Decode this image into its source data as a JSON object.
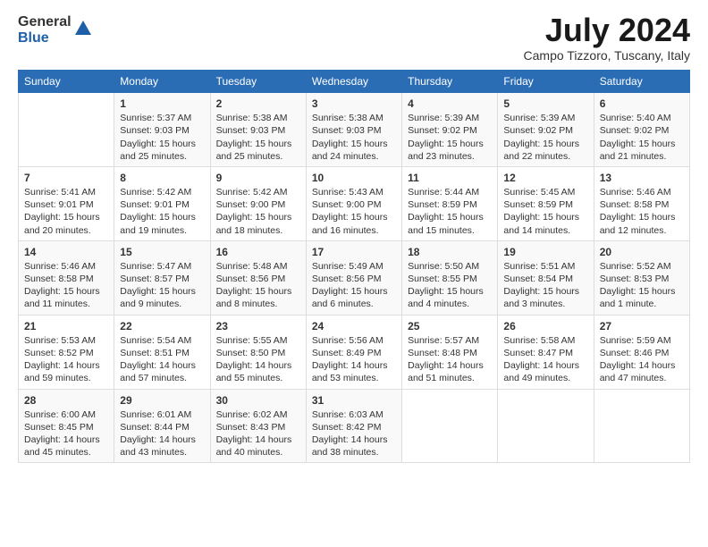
{
  "header": {
    "logo_general": "General",
    "logo_blue": "Blue",
    "month": "July 2024",
    "location": "Campo Tizzoro, Tuscany, Italy"
  },
  "weekdays": [
    "Sunday",
    "Monday",
    "Tuesday",
    "Wednesday",
    "Thursday",
    "Friday",
    "Saturday"
  ],
  "weeks": [
    [
      {
        "day": "",
        "info": ""
      },
      {
        "day": "1",
        "info": "Sunrise: 5:37 AM\nSunset: 9:03 PM\nDaylight: 15 hours\nand 25 minutes."
      },
      {
        "day": "2",
        "info": "Sunrise: 5:38 AM\nSunset: 9:03 PM\nDaylight: 15 hours\nand 25 minutes."
      },
      {
        "day": "3",
        "info": "Sunrise: 5:38 AM\nSunset: 9:03 PM\nDaylight: 15 hours\nand 24 minutes."
      },
      {
        "day": "4",
        "info": "Sunrise: 5:39 AM\nSunset: 9:02 PM\nDaylight: 15 hours\nand 23 minutes."
      },
      {
        "day": "5",
        "info": "Sunrise: 5:39 AM\nSunset: 9:02 PM\nDaylight: 15 hours\nand 22 minutes."
      },
      {
        "day": "6",
        "info": "Sunrise: 5:40 AM\nSunset: 9:02 PM\nDaylight: 15 hours\nand 21 minutes."
      }
    ],
    [
      {
        "day": "7",
        "info": "Sunrise: 5:41 AM\nSunset: 9:01 PM\nDaylight: 15 hours\nand 20 minutes."
      },
      {
        "day": "8",
        "info": "Sunrise: 5:42 AM\nSunset: 9:01 PM\nDaylight: 15 hours\nand 19 minutes."
      },
      {
        "day": "9",
        "info": "Sunrise: 5:42 AM\nSunset: 9:00 PM\nDaylight: 15 hours\nand 18 minutes."
      },
      {
        "day": "10",
        "info": "Sunrise: 5:43 AM\nSunset: 9:00 PM\nDaylight: 15 hours\nand 16 minutes."
      },
      {
        "day": "11",
        "info": "Sunrise: 5:44 AM\nSunset: 8:59 PM\nDaylight: 15 hours\nand 15 minutes."
      },
      {
        "day": "12",
        "info": "Sunrise: 5:45 AM\nSunset: 8:59 PM\nDaylight: 15 hours\nand 14 minutes."
      },
      {
        "day": "13",
        "info": "Sunrise: 5:46 AM\nSunset: 8:58 PM\nDaylight: 15 hours\nand 12 minutes."
      }
    ],
    [
      {
        "day": "14",
        "info": "Sunrise: 5:46 AM\nSunset: 8:58 PM\nDaylight: 15 hours\nand 11 minutes."
      },
      {
        "day": "15",
        "info": "Sunrise: 5:47 AM\nSunset: 8:57 PM\nDaylight: 15 hours\nand 9 minutes."
      },
      {
        "day": "16",
        "info": "Sunrise: 5:48 AM\nSunset: 8:56 PM\nDaylight: 15 hours\nand 8 minutes."
      },
      {
        "day": "17",
        "info": "Sunrise: 5:49 AM\nSunset: 8:56 PM\nDaylight: 15 hours\nand 6 minutes."
      },
      {
        "day": "18",
        "info": "Sunrise: 5:50 AM\nSunset: 8:55 PM\nDaylight: 15 hours\nand 4 minutes."
      },
      {
        "day": "19",
        "info": "Sunrise: 5:51 AM\nSunset: 8:54 PM\nDaylight: 15 hours\nand 3 minutes."
      },
      {
        "day": "20",
        "info": "Sunrise: 5:52 AM\nSunset: 8:53 PM\nDaylight: 15 hours\nand 1 minute."
      }
    ],
    [
      {
        "day": "21",
        "info": "Sunrise: 5:53 AM\nSunset: 8:52 PM\nDaylight: 14 hours\nand 59 minutes."
      },
      {
        "day": "22",
        "info": "Sunrise: 5:54 AM\nSunset: 8:51 PM\nDaylight: 14 hours\nand 57 minutes."
      },
      {
        "day": "23",
        "info": "Sunrise: 5:55 AM\nSunset: 8:50 PM\nDaylight: 14 hours\nand 55 minutes."
      },
      {
        "day": "24",
        "info": "Sunrise: 5:56 AM\nSunset: 8:49 PM\nDaylight: 14 hours\nand 53 minutes."
      },
      {
        "day": "25",
        "info": "Sunrise: 5:57 AM\nSunset: 8:48 PM\nDaylight: 14 hours\nand 51 minutes."
      },
      {
        "day": "26",
        "info": "Sunrise: 5:58 AM\nSunset: 8:47 PM\nDaylight: 14 hours\nand 49 minutes."
      },
      {
        "day": "27",
        "info": "Sunrise: 5:59 AM\nSunset: 8:46 PM\nDaylight: 14 hours\nand 47 minutes."
      }
    ],
    [
      {
        "day": "28",
        "info": "Sunrise: 6:00 AM\nSunset: 8:45 PM\nDaylight: 14 hours\nand 45 minutes."
      },
      {
        "day": "29",
        "info": "Sunrise: 6:01 AM\nSunset: 8:44 PM\nDaylight: 14 hours\nand 43 minutes."
      },
      {
        "day": "30",
        "info": "Sunrise: 6:02 AM\nSunset: 8:43 PM\nDaylight: 14 hours\nand 40 minutes."
      },
      {
        "day": "31",
        "info": "Sunrise: 6:03 AM\nSunset: 8:42 PM\nDaylight: 14 hours\nand 38 minutes."
      },
      {
        "day": "",
        "info": ""
      },
      {
        "day": "",
        "info": ""
      },
      {
        "day": "",
        "info": ""
      }
    ]
  ]
}
